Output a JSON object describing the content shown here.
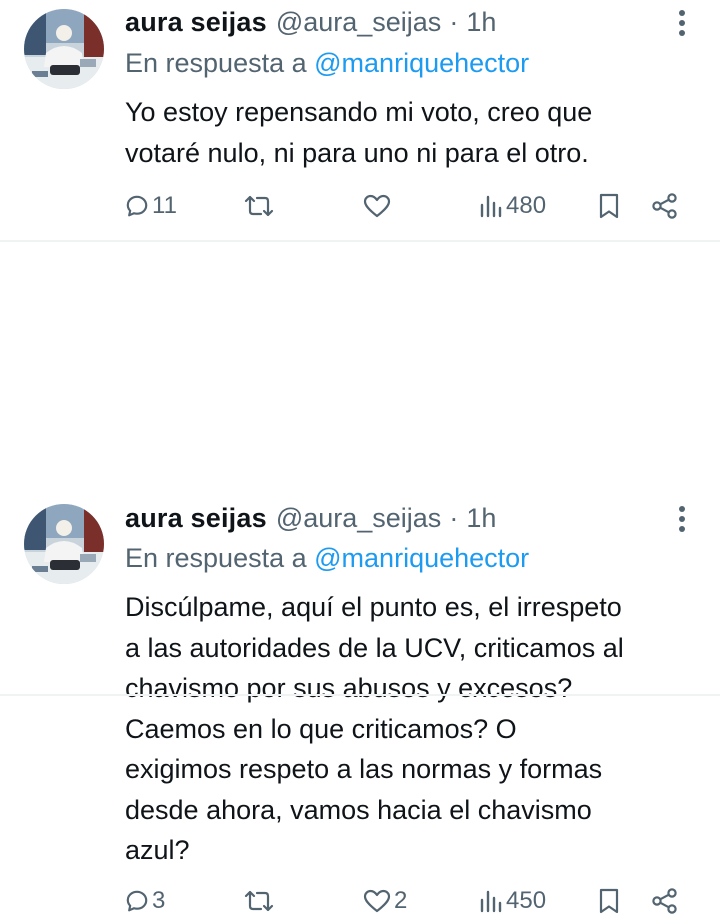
{
  "tweets": [
    {
      "author_name": "aura seijas",
      "author_handle": "@aura_seijas",
      "separator": "·",
      "time": "1h",
      "reply_prefix": "En respuesta a",
      "reply_to": "@manriquehector",
      "text": "Yo estoy repensando mi voto, creo que\nvotaré nulo, ni para uno ni para el otro.",
      "replies": "11",
      "retweets": "",
      "likes": "",
      "views": "480"
    },
    {
      "author_name": "aura seijas",
      "author_handle": "@aura_seijas",
      "separator": "·",
      "time": "1h",
      "reply_prefix": "En respuesta a",
      "reply_to": "@manriquehector",
      "text": "Discúlpame, aquí el punto es, el irrespeto\na las autoridades de la UCV, criticamos al\nchavismo por sus abusos y excesos?\nCaemos en lo que criticamos? O\nexigimos respeto a las normas y formas\ndesde ahora, vamos hacia el chavismo\nazul?",
      "replies": "3",
      "retweets": "",
      "likes": "2",
      "views": "450"
    }
  ],
  "colors": {
    "text": "#0f1419",
    "secondary": "#536471",
    "link": "#1d9bf0",
    "divider": "#eff3f4"
  },
  "icons": [
    "more-vertical-icon",
    "reply-icon",
    "retweet-icon",
    "like-icon",
    "views-icon",
    "bookmark-icon",
    "share-icon"
  ]
}
